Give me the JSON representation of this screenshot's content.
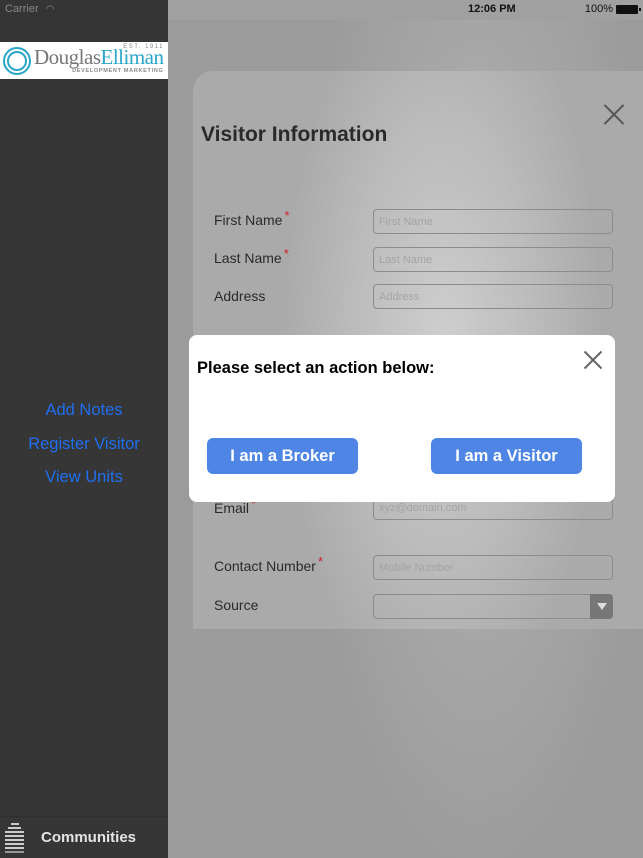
{
  "status_bar": {
    "carrier": "Carrier",
    "wifi_icon": "wifi-icon",
    "time": "12:06 PM",
    "battery": "100%",
    "battery_icon": "battery-icon"
  },
  "sidebar": {
    "logo": {
      "mark": "DE",
      "name_part1": "Douglas",
      "name_part2": "Elliman",
      "established": "EST. 1911",
      "subtitle": "DEVELOPMENT MARKETING"
    },
    "menu": [
      {
        "label": "Add Notes"
      },
      {
        "label": "Register Visitor"
      },
      {
        "label": "View Units"
      }
    ],
    "bottom": {
      "icon": "building-icon",
      "label": "Communities"
    }
  },
  "form": {
    "title": "Visitor Information",
    "fields": [
      {
        "label": "First Name",
        "required": "*",
        "placeholder": "First Name",
        "value": ""
      },
      {
        "label": "Last Name",
        "required": "*",
        "placeholder": "Last Name",
        "value": ""
      },
      {
        "label": "Address",
        "required": "",
        "placeholder": "Address",
        "value": ""
      },
      {
        "label": "Email",
        "required": "*",
        "placeholder": "xyz@domain.com",
        "value": ""
      },
      {
        "label": "Contact Number",
        "required": "*",
        "placeholder": "Mobile Number",
        "value": ""
      },
      {
        "label": "Source",
        "required": "",
        "placeholder": "",
        "value": ""
      }
    ]
  },
  "dialog": {
    "title": "Please select an action below:",
    "broker_button": "I am a Broker",
    "visitor_button": "I am a Visitor"
  },
  "colors": {
    "accent_blue": "#4f86e6",
    "link_blue": "#1f6ff0",
    "required_red": "#d0202a",
    "sidebar_bg": "#363636"
  }
}
